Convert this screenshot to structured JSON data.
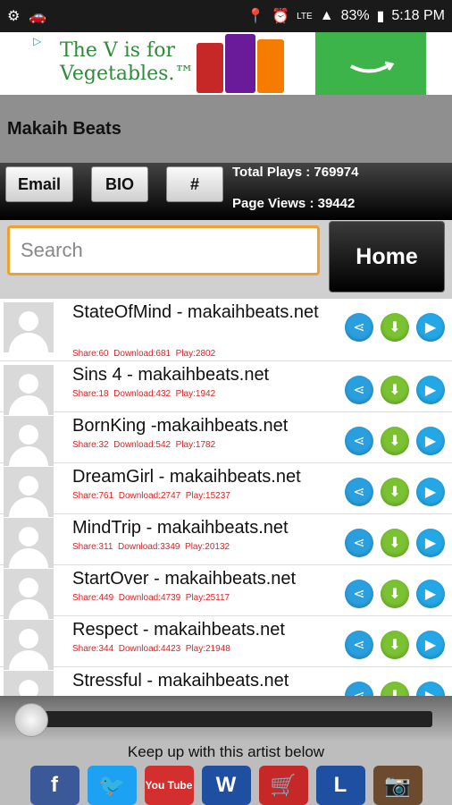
{
  "statusbar": {
    "signal": "LTE",
    "battery": "83%",
    "time": "5:18 PM"
  },
  "ad": {
    "choice": "▷",
    "headline": "The V is for Vegetables.™"
  },
  "header": {
    "title": "Makaih Beats"
  },
  "toolbar": {
    "email_label": "Email",
    "bio_label": "BIO",
    "hash_label": "#",
    "total_plays": "Total Plays : 769974",
    "page_views": "Page Views : 39442"
  },
  "search": {
    "placeholder": "Search"
  },
  "home_label": "Home",
  "tracks": [
    {
      "title": "StateOfMind - makaihbeats.net",
      "share": "Share:60",
      "download": "Download:681",
      "play": "Play:2802"
    },
    {
      "title": "Sins 4 - makaihbeats.net",
      "share": "Share:18",
      "download": "Download:432",
      "play": "Play:1942"
    },
    {
      "title": "BornKing -makaihbeats.net",
      "share": "Share:32",
      "download": "Download:542",
      "play": "Play:1782"
    },
    {
      "title": "DreamGirl - makaihbeats.net",
      "share": "Share:761",
      "download": "Download:2747",
      "play": "Play:15237"
    },
    {
      "title": "MindTrip - makaihbeats.net",
      "share": "Share:311",
      "download": "Download:3349",
      "play": "Play:20132"
    },
    {
      "title": "StartOver - makaihbeats.net",
      "share": "Share:449",
      "download": "Download:4739",
      "play": "Play:25117"
    },
    {
      "title": "Respect - makaihbeats.net",
      "share": "Share:344",
      "download": "Download:4423",
      "play": "Play:21948"
    },
    {
      "title": "Stressful - makaihbeats.net",
      "share": "",
      "download": "",
      "play": ""
    }
  ],
  "player": {
    "position": 0
  },
  "follow_text": "Keep up with this artist below",
  "social": [
    {
      "name": "facebook",
      "glyph": "f",
      "color": "#3b5998"
    },
    {
      "name": "twitter",
      "glyph": "🐦",
      "color": "#1da1f2"
    },
    {
      "name": "youtube",
      "glyph": "You Tube",
      "color": "#d32f2f"
    },
    {
      "name": "website",
      "glyph": "W",
      "color": "#1e4fa0"
    },
    {
      "name": "shop",
      "glyph": "🛒",
      "color": "#c62828"
    },
    {
      "name": "link",
      "glyph": "L",
      "color": "#1e4fa0"
    },
    {
      "name": "instagram",
      "glyph": "📷",
      "color": "#6b4a2e"
    }
  ]
}
